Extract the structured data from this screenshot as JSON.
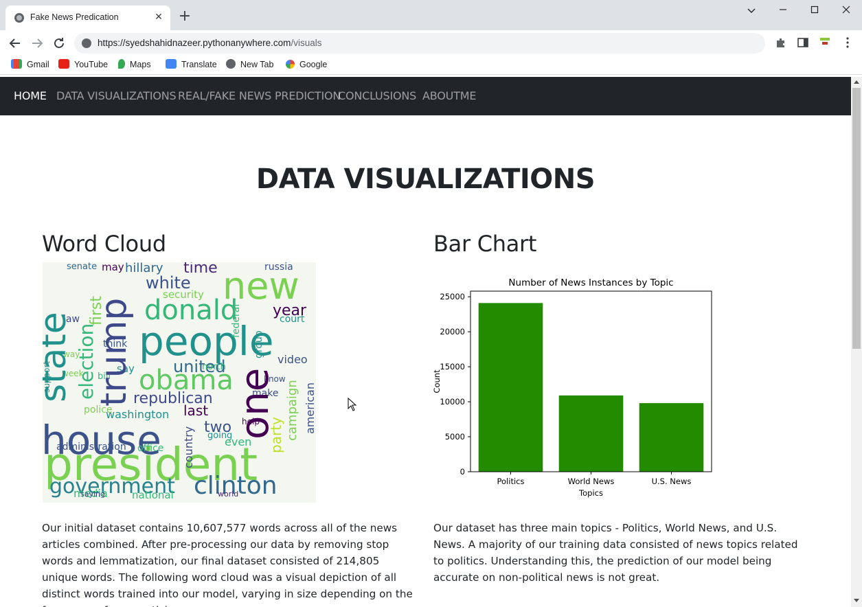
{
  "browser": {
    "tab_title": "Fake News Predication",
    "url_host": "https://syedshahidnazeer.pythonanywhere.com",
    "url_path": "/visuals",
    "bookmarks": [
      "Gmail",
      "YouTube",
      "Maps",
      "Translate",
      "New Tab",
      "Google"
    ]
  },
  "nav": {
    "items": [
      "HOME",
      "DATA VISUALIZATIONS",
      "REAL/FAKE NEWS PREDICTION",
      "CONCLUSIONS",
      "ABOUTME"
    ]
  },
  "page": {
    "title": "DATA VISUALIZATIONS",
    "wordcloud_heading": "Word Cloud",
    "barchart_heading": "Bar Chart",
    "wordcloud_desc": "Our initial dataset contains 10,607,577 words across all of the news articles combined. After pre-processing our data by removing stop words and lemmatization, our final dataset consisted of 214,805 unique words. The following word cloud was a visual depiction of all distinct words trained into our model, varying in size depending on the frequency of news articles.",
    "barchart_desc": "Our dataset has three main topics - Politics, World News, and U.S. News. A majority of our training data consisted of news topics related to politics. Understanding this, the prediction of our model being accurate on non-political news is not great."
  },
  "chart_data": {
    "type": "bar",
    "title": "Number of News Instances by Topic",
    "xlabel": "Topics",
    "ylabel": "Count",
    "categories": [
      "Politics",
      "World News",
      "U.S. News"
    ],
    "values": [
      24100,
      10900,
      9800
    ],
    "ylim": [
      0,
      25800
    ],
    "yticks": [
      0,
      5000,
      10000,
      15000,
      20000,
      25000
    ],
    "bar_color": "#228b00"
  },
  "colors": {
    "navbar_bg": "#212529",
    "text": "#212529"
  }
}
